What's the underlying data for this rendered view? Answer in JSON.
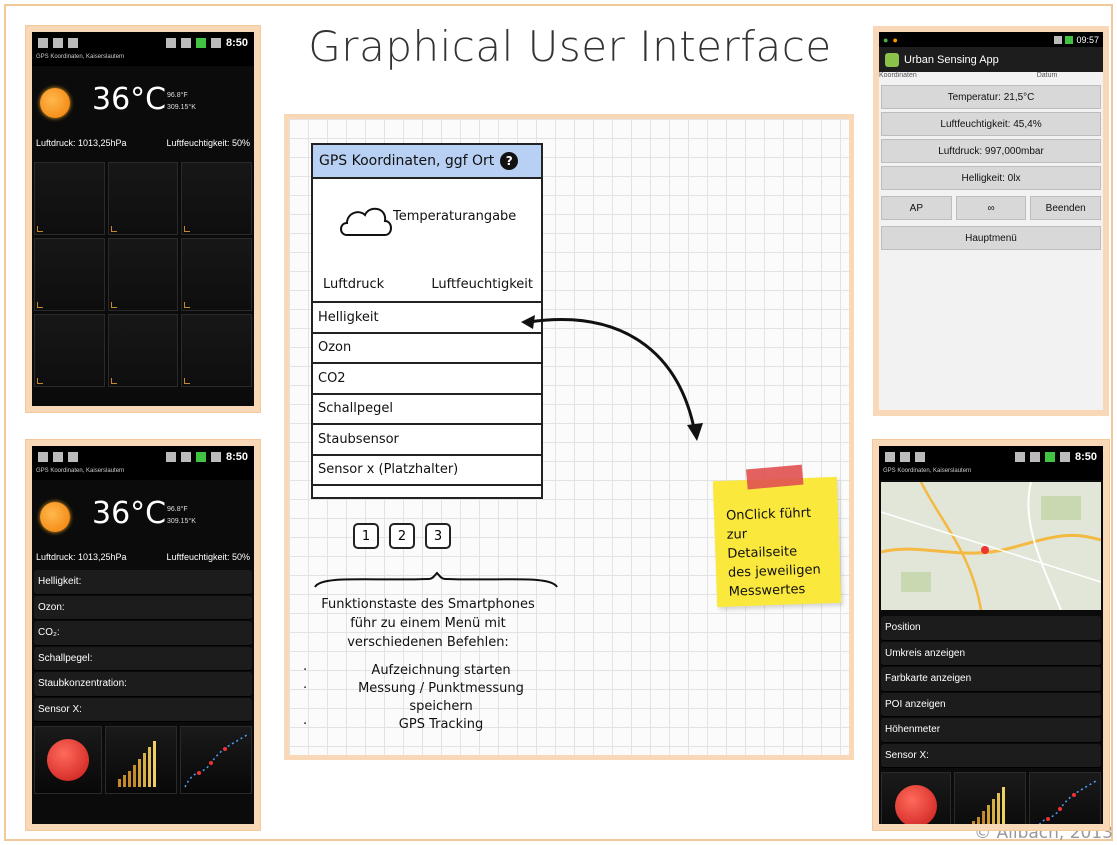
{
  "slide": {
    "title": "Graphical User Interface",
    "copyright": "© Allbach, 2013"
  },
  "status": {
    "time": "8:50",
    "subtitle": "GPS Koordinaten, Kaiserslautern"
  },
  "weather": {
    "temp": "36°C",
    "temp_f": "96.8°F",
    "temp_k": "309.15°K",
    "pressure": "Luftdruck: 1013,25hPa",
    "humidity": "Luftfeuchtigkeit: 50%"
  },
  "phone_list": [
    "Helligkeit:",
    "Ozon:",
    "CO₂:",
    "Schallpegel:",
    "Staubkonzentration:",
    "Sensor X:"
  ],
  "map_list": [
    "Position",
    "Umkreis anzeigen",
    "Farbkarte anzeigen",
    "POI anzeigen",
    "Höhenmeter",
    "Sensor X:"
  ],
  "app": {
    "time": "09:57",
    "title": "Urban Sensing App",
    "col_left": "Koordinaten",
    "col_right": "Datum",
    "temperature": "Temperatur: 21,5°C",
    "humidity": "Luftfeuchtigkeit: 45,4%",
    "pressure": "Luftdruck: 997,000mbar",
    "brightness": "Helligkeit: 0lx",
    "btn_ap": "AP",
    "btn_inf": "∞",
    "btn_end": "Beenden",
    "btn_menu": "Hauptmenü"
  },
  "mockup": {
    "header": "GPS Koordinaten, ggf Ort",
    "help": "?",
    "temperature": "Temperaturangabe",
    "pressure": "Luftdruck",
    "humidity": "Luftfeuchtigkeit",
    "items": [
      "Helligkeit",
      "Ozon",
      "CO2",
      "Schallpegel",
      "Staubsensor",
      "Sensor x (Platzhalter)"
    ],
    "pages": [
      "1",
      "2",
      "3"
    ],
    "note_lines": [
      "Funktionstaste des Smartphones",
      "führ zu einem Menü mit",
      "verschiedenen Befehlen:"
    ],
    "bullets": [
      "Aufzeichnung starten",
      "Messung / Punktmessung speichern",
      "GPS Tracking"
    ],
    "sticky_lines": [
      "OnClick führt",
      "zur",
      "Detailseite",
      "des jeweiligen",
      "Messwertes"
    ]
  },
  "colors": {
    "frame": "#f8d8b6",
    "mockup_header": "#b8d0f4",
    "sticky": "#fbe83c",
    "accent_orange": "#f07d05"
  }
}
